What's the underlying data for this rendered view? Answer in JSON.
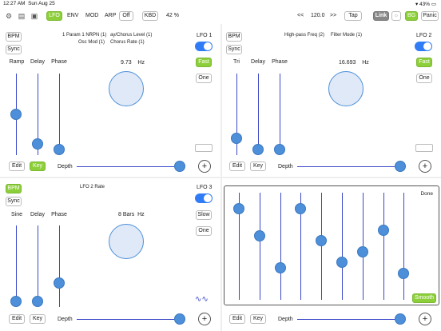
{
  "status": {
    "time": "12:27 AM",
    "date": "Sun Aug 25",
    "battery": "43%"
  },
  "toolbar": {
    "icons": [
      "gear-icon",
      "notes-icon",
      "save-icon"
    ],
    "tabs": [
      "LFO",
      "ENV",
      "MOD",
      "ARP",
      "Off",
      "KBD"
    ],
    "active_tab": "LFO",
    "percent": "42 %",
    "prev": "<<",
    "tempo": "120.0",
    "next": ">>",
    "tap": "Tap",
    "link": "Link",
    "bg": "BG",
    "panic": "Panic"
  },
  "lfo1": {
    "title": "LFO 1",
    "bpm": "BPM",
    "sync": "Sync",
    "dest1": "1 Param 1 NRPN (1)",
    "dest2": "Osc Mod (1)",
    "dest3": "ay/Chorus Level (1)",
    "dest4": "Chorus Rate (1)",
    "cols": [
      "Ramp",
      "Delay",
      "Phase"
    ],
    "rate": "9.73",
    "unit": "Hz",
    "speed": "Fast",
    "mode": "One",
    "edit": "Edit",
    "key": "Key",
    "depth": "Depth"
  },
  "lfo2": {
    "title": "LFO 2",
    "bpm": "BPM",
    "sync": "Sync",
    "dest1": "High-pass Freq (2)",
    "dest2": "Filter Mode (1)",
    "cols": [
      "Tri",
      "Delay",
      "Phase"
    ],
    "rate": "16.693",
    "unit": "Hz",
    "speed": "Fast",
    "mode": "One",
    "edit": "Edit",
    "key": "Key",
    "depth": "Depth"
  },
  "lfo3": {
    "title": "LFO 3",
    "bpm": "BPM",
    "sync": "Sync",
    "dest1": "LFO 2 Rate",
    "cols": [
      "Sine",
      "Delay",
      "Phase"
    ],
    "rate": "8 Bars",
    "unit": "Hz",
    "speed": "Slow",
    "mode": "One",
    "edit": "Edit",
    "key": "Key",
    "depth": "Depth"
  },
  "lfo4": {
    "edit": "Edit",
    "key": "Key",
    "depth": "Depth"
  },
  "stepper": {
    "done": "Done",
    "smooth": "Smooth",
    "steps": [
      0.85,
      0.6,
      0.3,
      0.85,
      0.55,
      0.35,
      0.45,
      0.65,
      0.25
    ]
  },
  "colors": {
    "accent": "#8dcf3a",
    "knob": "#4d8fd8",
    "track": "#3b49c7",
    "toggle": "#2f7cf6"
  }
}
